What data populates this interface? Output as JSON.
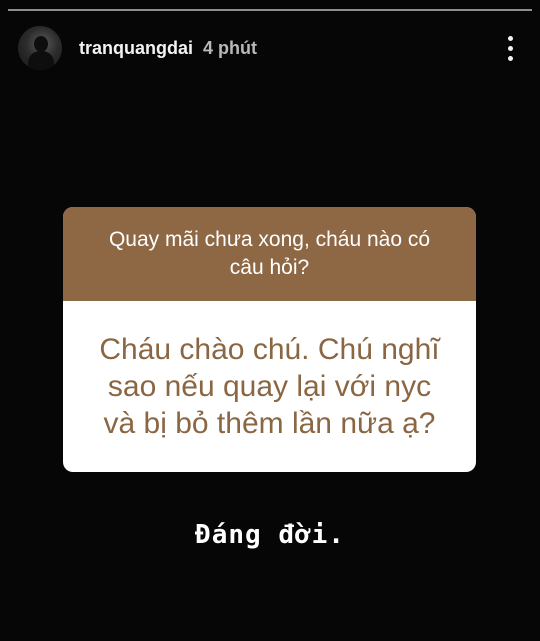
{
  "story": {
    "progress_segments": 1
  },
  "header": {
    "username": "tranquangdai",
    "time": "4 phút",
    "avatar_icon": "user-avatar",
    "menu_icon": "more-vertical-icon"
  },
  "question_card": {
    "prompt": "Quay mãi chưa xong, cháu nào có câu hỏi?",
    "answer": "Cháu chào chú. Chú nghĩ sao nếu quay lại với nyc và bị bỏ thêm lần nữa ạ?",
    "colors": {
      "prompt_background": "#8e6845",
      "answer_text": "#8a6642",
      "answer_background": "#ffffff"
    }
  },
  "reply_text": "Đáng đời."
}
